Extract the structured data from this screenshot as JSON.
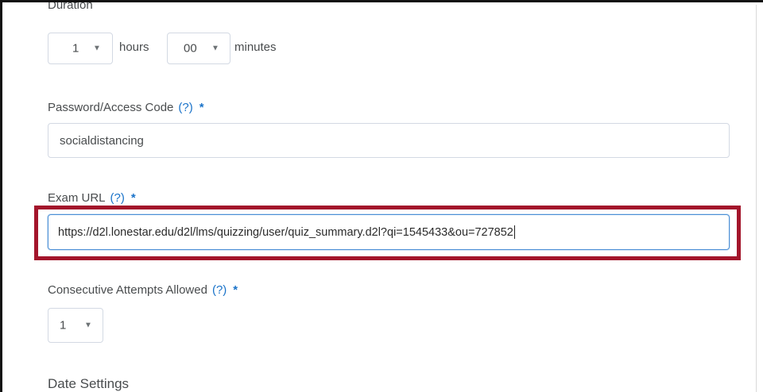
{
  "duration": {
    "label": "Duration",
    "hours_value": "1",
    "hours_unit": "hours",
    "minutes_value": "00",
    "minutes_unit": "minutes"
  },
  "password": {
    "label": "Password/Access Code",
    "help": "(?)",
    "required": "*",
    "value": "socialdistancing"
  },
  "exam_url": {
    "label": "Exam URL",
    "help": "(?)",
    "required": "*",
    "value": "https://d2l.lonestar.edu/d2l/lms/quizzing/user/quiz_summary.d2l?qi=1545433&ou=727852"
  },
  "attempts": {
    "label": "Consecutive Attempts Allowed",
    "help": "(?)",
    "required": "*",
    "value": "1"
  },
  "date_settings": {
    "title": "Date Settings"
  },
  "colors": {
    "highlight": "#a3152b",
    "link": "#1a73c9"
  },
  "icons": {
    "caret": "chevron-down-icon"
  }
}
